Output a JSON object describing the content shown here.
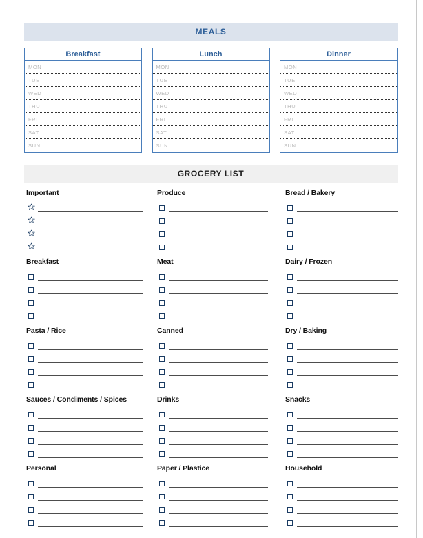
{
  "meals": {
    "banner_label": "MEALS",
    "columns": [
      {
        "title": "Breakfast"
      },
      {
        "title": "Lunch"
      },
      {
        "title": "Dinner"
      }
    ],
    "days": [
      "MON",
      "TUE",
      "WED",
      "THU",
      "FRI",
      "SAT",
      "SUN"
    ]
  },
  "grocery": {
    "banner_label": "GROCERY LIST",
    "categories": [
      {
        "title": "Important",
        "marker": "star-icon",
        "rows": 4
      },
      {
        "title": "Produce",
        "marker": "checkbox-icon",
        "rows": 4
      },
      {
        "title": "Bread / Bakery",
        "marker": "checkbox-icon",
        "rows": 4
      },
      {
        "title": "Breakfast",
        "marker": "checkbox-icon",
        "rows": 4
      },
      {
        "title": "Meat",
        "marker": "checkbox-icon",
        "rows": 4
      },
      {
        "title": "Dairy / Frozen",
        "marker": "checkbox-icon",
        "rows": 4
      },
      {
        "title": "Pasta / Rice",
        "marker": "checkbox-icon",
        "rows": 4
      },
      {
        "title": "Canned",
        "marker": "checkbox-icon",
        "rows": 4
      },
      {
        "title": "Dry / Baking",
        "marker": "checkbox-icon",
        "rows": 4
      },
      {
        "title": "Sauces / Condiments / Spices",
        "marker": "checkbox-icon",
        "rows": 4
      },
      {
        "title": "Drinks",
        "marker": "checkbox-icon",
        "rows": 4
      },
      {
        "title": "Snacks",
        "marker": "checkbox-icon",
        "rows": 4
      },
      {
        "title": "Personal",
        "marker": "checkbox-icon",
        "rows": 4
      },
      {
        "title": "Paper / Plastice",
        "marker": "checkbox-icon",
        "rows": 4
      },
      {
        "title": "Household",
        "marker": "checkbox-icon",
        "rows": 4
      }
    ]
  },
  "colors": {
    "meals_banner_bg": "#dce3ed",
    "meals_banner_text": "#2f6099",
    "grocery_banner_bg": "#f0f0f0",
    "grocery_banner_text": "#1e1e1e",
    "meal_box_border": "#4a7ebb",
    "day_label_text": "#b9b9b9",
    "write_line": "#4d4d4d",
    "checkbox_border": "#1b3c63"
  }
}
